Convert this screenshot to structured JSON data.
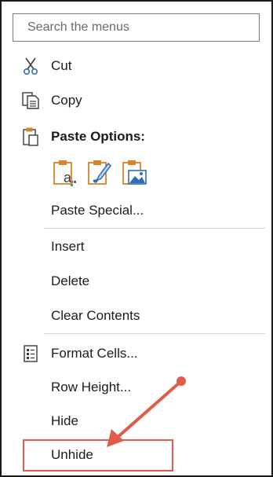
{
  "search": {
    "placeholder": "Search the menus"
  },
  "menu": {
    "cut": "Cut",
    "copy": "Copy",
    "paste_options": "Paste Options:",
    "paste_special": "Paste Special...",
    "insert": "Insert",
    "delete": "Delete",
    "clear_contents": "Clear Contents",
    "format_cells": "Format Cells...",
    "row_height": "Row Height...",
    "hide": "Hide",
    "unhide": "Unhide"
  },
  "icons": {
    "cut": "scissors-icon",
    "copy": "copy-icon",
    "paste": "clipboard-icon",
    "paste_text": "paste-text-icon",
    "paste_formatting": "paste-formatting-icon",
    "paste_picture": "paste-picture-icon",
    "format_cells": "format-cells-icon"
  },
  "colors": {
    "accent_orange": "#d9822b",
    "accent_blue": "#2f6db5",
    "annotation_red": "#e15b4b"
  }
}
